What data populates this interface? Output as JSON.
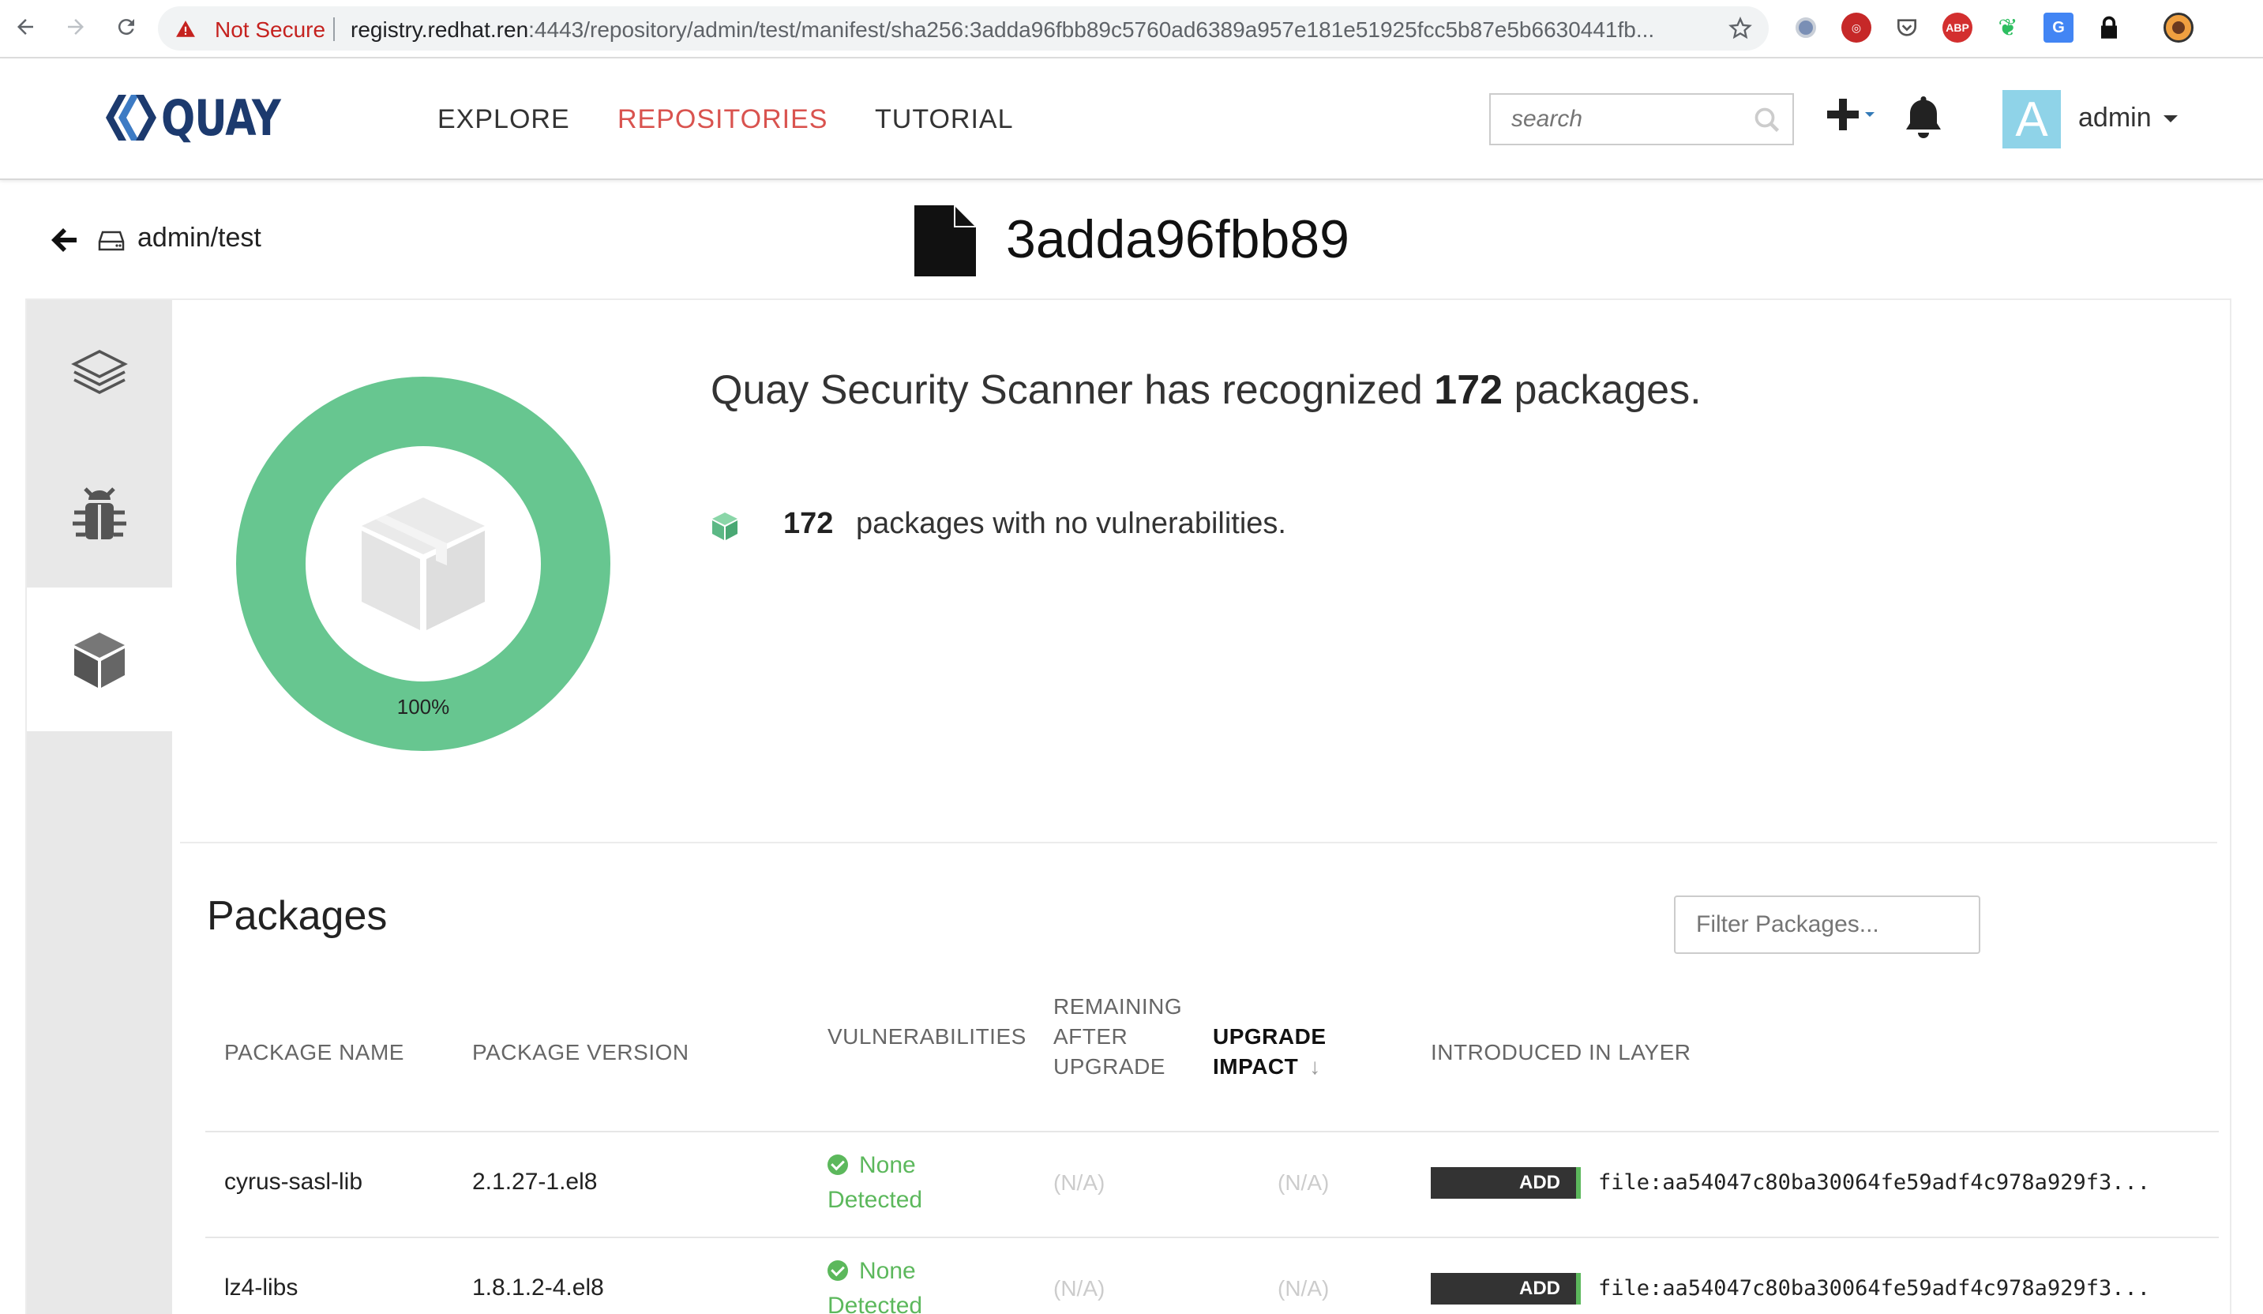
{
  "browser": {
    "security_label": "Not Secure",
    "url_host": "registry.redhat.ren",
    "url_rest": ":4443/repository/admin/test/manifest/sha256:3adda96fbb89c5760ad6389a957e181e51925fcc5b87e5b6630441fb...",
    "extensions": [
      "chrome-ext-icon",
      "ext-red-icon",
      "pocket-icon",
      "abp-icon",
      "evernote-icon",
      "translate-icon",
      "lock-icon",
      "profile-icon"
    ]
  },
  "header": {
    "logo_text": "QUAY",
    "nav": [
      "EXPLORE",
      "REPOSITORIES",
      "TUTORIAL"
    ],
    "active_nav": "REPOSITORIES",
    "search_placeholder": "search",
    "avatar_letter": "A",
    "username": "admin",
    "colors": {
      "active_nav": "#d9534f",
      "logo": "#1c3a6e",
      "avatar_bg": "#8fd3e8"
    }
  },
  "title_bar": {
    "repo": "admin/test",
    "manifest_short": "3adda96fbb89"
  },
  "side_tabs": [
    {
      "name": "layers",
      "icon": "layers-icon",
      "active": false
    },
    {
      "name": "vulnerabilities",
      "icon": "bug-icon",
      "active": false
    },
    {
      "name": "packages",
      "icon": "package-icon",
      "active": true
    }
  ],
  "scan_summary": {
    "prefix": "Quay Security Scanner has recognized",
    "count": "172",
    "suffix": "packages.",
    "donut_percent_label": "100%",
    "donut_fraction": 1.0,
    "donut_color": "#67c690",
    "line_count": "172",
    "line_text": "packages with no vulnerabilities."
  },
  "packages": {
    "title": "Packages",
    "filter_placeholder": "Filter Packages...",
    "columns": {
      "name": "PACKAGE NAME",
      "version": "PACKAGE VERSION",
      "vulnerabilities": "VULNERABILITIES",
      "remaining": [
        "REMAINING",
        "AFTER",
        "UPGRADE"
      ],
      "impact": [
        "UPGRADE",
        "IMPACT"
      ],
      "sort_arrow": "↓",
      "layer": "INTRODUCED IN LAYER"
    },
    "rows": [
      {
        "name": "cyrus-sasl-lib",
        "version": "2.1.27-1.el8",
        "vuln": [
          "None",
          "Detected"
        ],
        "remaining": "(N/A)",
        "impact": "(N/A)",
        "layer_cmd": "ADD",
        "layer_file": "file:aa54047c80ba30064fe59adf4c978a929f3..."
      },
      {
        "name": "lz4-libs",
        "version": "1.8.1.2-4.el8",
        "vuln": [
          "None",
          "Detected"
        ],
        "remaining": "(N/A)",
        "impact": "(N/A)",
        "layer_cmd": "ADD",
        "layer_file": "file:aa54047c80ba30064fe59adf4c978a929f3..."
      }
    ]
  }
}
